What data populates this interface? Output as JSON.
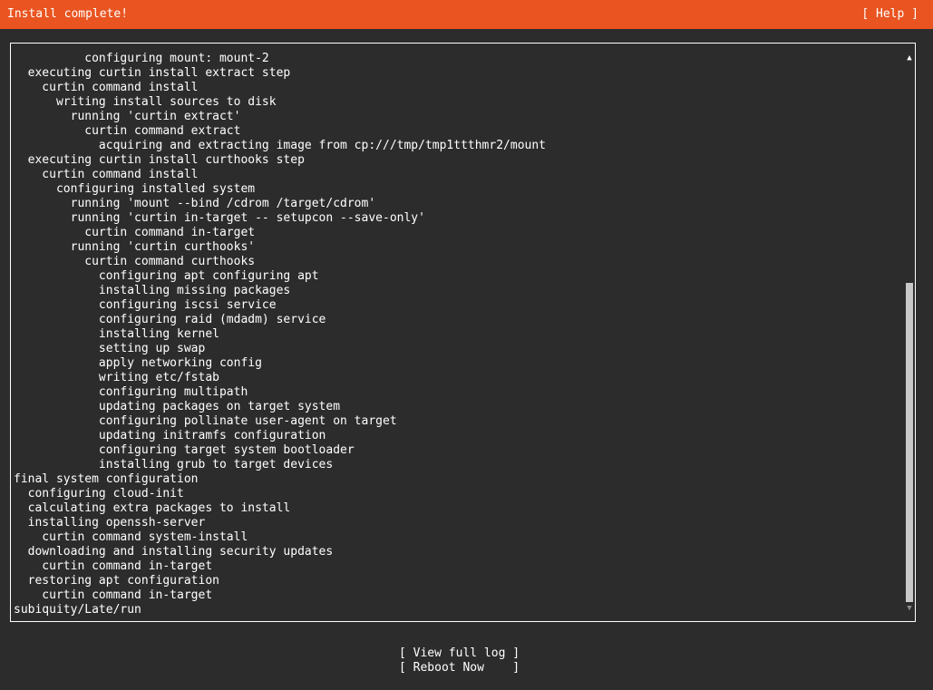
{
  "header": {
    "title": "Install complete!",
    "help_label": "[ Help ]"
  },
  "log": {
    "lines": [
      "          configuring mount: mount-2",
      "  executing curtin install extract step",
      "    curtin command install",
      "      writing install sources to disk",
      "        running 'curtin extract'",
      "          curtin command extract",
      "            acquiring and extracting image from cp:///tmp/tmp1ttthmr2/mount",
      "  executing curtin install curthooks step",
      "    curtin command install",
      "      configuring installed system",
      "        running 'mount --bind /cdrom /target/cdrom'",
      "        running 'curtin in-target -- setupcon --save-only'",
      "          curtin command in-target",
      "        running 'curtin curthooks'",
      "          curtin command curthooks",
      "            configuring apt configuring apt",
      "            installing missing packages",
      "            configuring iscsi service",
      "            configuring raid (mdadm) service",
      "            installing kernel",
      "            setting up swap",
      "            apply networking config",
      "            writing etc/fstab",
      "            configuring multipath",
      "            updating packages on target system",
      "            configuring pollinate user-agent on target",
      "            updating initramfs configuration",
      "            configuring target system bootloader",
      "            installing grub to target devices",
      "final system configuration",
      "  configuring cloud-init",
      "  calculating extra packages to install",
      "  installing openssh-server",
      "    curtin command system-install",
      "  downloading and installing security updates",
      "    curtin command in-target",
      "  restoring apt configuration",
      "    curtin command in-target",
      "subiquity/Late/run"
    ]
  },
  "scrollbar": {
    "up_glyph": "▲",
    "down_glyph": "▼"
  },
  "actions": {
    "view_log_label": "[ View full log ]",
    "reboot_label": "[ Reboot Now    ]"
  },
  "colors": {
    "header_bg": "#e95420",
    "background": "#2c2c2c",
    "text": "#ffffff"
  }
}
